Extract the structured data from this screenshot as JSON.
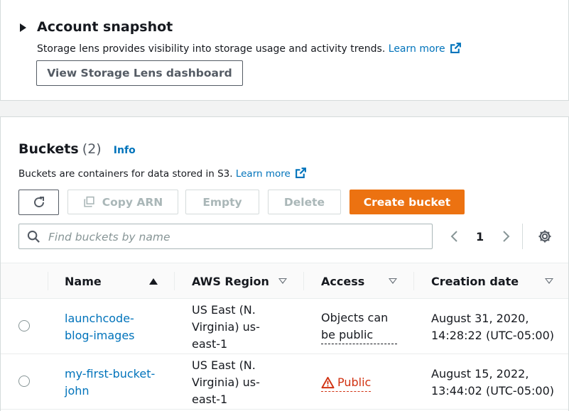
{
  "snapshot": {
    "title": "Account snapshot",
    "description": "Storage lens provides visibility into storage usage and activity trends.",
    "learn_more": "Learn more",
    "dashboard_button": "View Storage Lens dashboard"
  },
  "buckets": {
    "title": "Buckets",
    "count": "(2)",
    "info": "Info",
    "description": "Buckets are containers for data stored in S3.",
    "learn_more": "Learn more",
    "actions": {
      "copy_arn": "Copy ARN",
      "empty": "Empty",
      "delete": "Delete",
      "create": "Create bucket"
    },
    "search_placeholder": "Find buckets by name",
    "page": "1",
    "columns": {
      "name": "Name",
      "region": "AWS Region",
      "access": "Access",
      "created": "Creation date"
    },
    "rows": [
      {
        "name_1": "launchcode-",
        "name_2": "blog-images",
        "region_1": "US East (N.",
        "region_2": "Virginia) us-",
        "region_3": "east-1",
        "access_1": "Objects can",
        "access_2": "be public",
        "created_1": "August 31, 2020,",
        "created_2": "14:28:22 (UTC-05:00)"
      },
      {
        "name_1": "my-first-bucket-",
        "name_2": "john",
        "region_1": "US East (N.",
        "region_2": "Virginia) us-",
        "region_3": "east-1",
        "access_1": "Public",
        "created_1": "August 15, 2022,",
        "created_2": "13:44:02 (UTC-05:00)"
      }
    ]
  },
  "colors": {
    "primary": "#ec7211",
    "link": "#0073bb",
    "warning": "#d13212"
  }
}
